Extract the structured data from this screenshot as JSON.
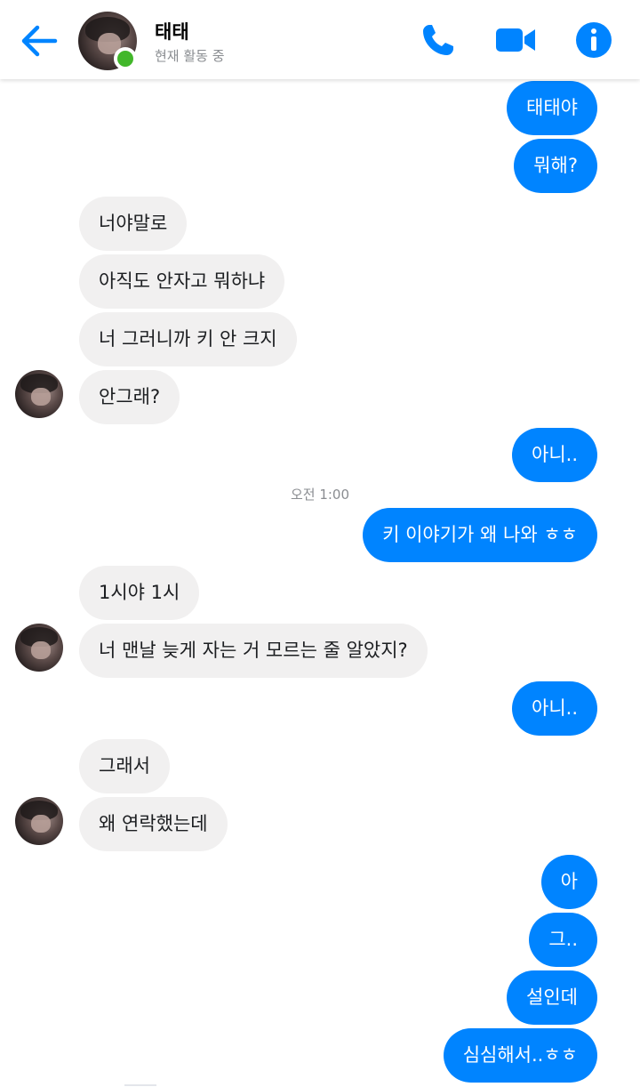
{
  "header": {
    "contact_name": "태태",
    "status": "현재 활동 중",
    "icons": {
      "back": "back-arrow-icon",
      "call": "phone-icon",
      "video": "video-camera-icon",
      "info": "info-icon"
    },
    "accent_color": "#0084ff",
    "online_color": "#42b72a"
  },
  "conversation": {
    "timestamp": "오전 1:00",
    "messages": [
      {
        "sender": "me",
        "text": "태태야"
      },
      {
        "sender": "me",
        "text": "뭐해?"
      },
      {
        "sender": "them",
        "text": "너야말로"
      },
      {
        "sender": "them",
        "text": "아직도 안자고 뭐하냐"
      },
      {
        "sender": "them",
        "text": "너 그러니까 키 안 크지"
      },
      {
        "sender": "them",
        "text": "안그래?"
      },
      {
        "sender": "me",
        "text": "아니.."
      },
      {
        "sender": "me",
        "text": "키 이야기가 왜 나와 ㅎㅎ"
      },
      {
        "sender": "them",
        "text": "1시야 1시"
      },
      {
        "sender": "them",
        "text": "너 맨날 늦게 자는 거 모르는 줄 알았지?"
      },
      {
        "sender": "me",
        "text": "아니.."
      },
      {
        "sender": "them",
        "text": "그래서"
      },
      {
        "sender": "them",
        "text": "왜 연락했는데"
      },
      {
        "sender": "me",
        "text": "아"
      },
      {
        "sender": "me",
        "text": "그.."
      },
      {
        "sender": "me",
        "text": "설인데"
      },
      {
        "sender": "me",
        "text": "심심해서..ㅎㅎ"
      }
    ]
  }
}
